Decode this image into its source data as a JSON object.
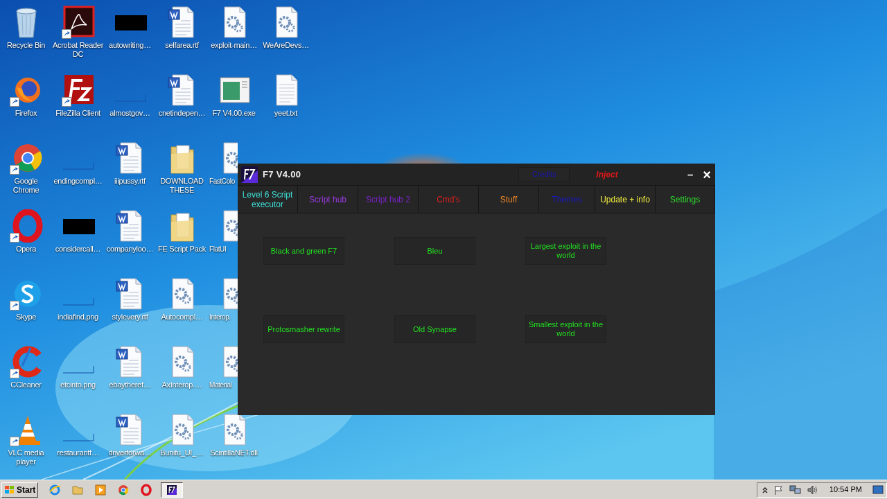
{
  "desktop_icons": [
    {
      "label": "Recycle Bin",
      "kind": "recycle",
      "shortcut": false,
      "clipped": false
    },
    {
      "label": "Firefox",
      "kind": "firefox",
      "shortcut": true,
      "clipped": false
    },
    {
      "label": "Google Chrome",
      "kind": "chrome",
      "shortcut": true,
      "clipped": false
    },
    {
      "label": "Opera",
      "kind": "opera",
      "shortcut": true,
      "clipped": false
    },
    {
      "label": "Skype",
      "kind": "skype",
      "shortcut": true,
      "clipped": false
    },
    {
      "label": "CCleaner",
      "kind": "ccleaner",
      "shortcut": true,
      "clipped": false
    },
    {
      "label": "VLC media player",
      "kind": "vlc",
      "shortcut": true,
      "clipped": false
    },
    {
      "label": "Acrobat Reader DC",
      "kind": "acrobat",
      "shortcut": true,
      "clipped": false
    },
    {
      "label": "FileZilla Client",
      "kind": "filezilla",
      "shortcut": true,
      "clipped": false
    },
    {
      "label": "endingcompl…",
      "kind": "blank",
      "shortcut": false,
      "clipped": false
    },
    {
      "label": "considercall…",
      "kind": "black",
      "shortcut": false,
      "clipped": false
    },
    {
      "label": "indiafind.png",
      "kind": "blank",
      "shortcut": false,
      "clipped": false
    },
    {
      "label": "etcinto.png",
      "kind": "blank",
      "shortcut": false,
      "clipped": false
    },
    {
      "label": "restaurantf…",
      "kind": "blank",
      "shortcut": false,
      "clipped": false
    },
    {
      "label": "autowriting…",
      "kind": "black",
      "shortcut": false,
      "clipped": false
    },
    {
      "label": "almostgov…",
      "kind": "blank",
      "shortcut": false,
      "clipped": false
    },
    {
      "label": "iiipussy.rtf",
      "kind": "word",
      "shortcut": false,
      "clipped": false
    },
    {
      "label": "companyloo…",
      "kind": "word",
      "shortcut": false,
      "clipped": false
    },
    {
      "label": "stylevery.rtf",
      "kind": "word",
      "shortcut": false,
      "clipped": false
    },
    {
      "label": "ebaytheref…",
      "kind": "word",
      "shortcut": false,
      "clipped": false
    },
    {
      "label": "driverforwa…",
      "kind": "word",
      "shortcut": false,
      "clipped": false
    },
    {
      "label": "selfarea.rtf",
      "kind": "word",
      "shortcut": false,
      "clipped": false
    },
    {
      "label": "cnetindepen…",
      "kind": "word",
      "shortcut": false,
      "clipped": false
    },
    {
      "label": "DOWNLOAD THESE",
      "kind": "folder",
      "shortcut": false,
      "clipped": false
    },
    {
      "label": "FE Script Pack",
      "kind": "folder",
      "shortcut": false,
      "clipped": false
    },
    {
      "label": "Autocompl…",
      "kind": "gear",
      "shortcut": false,
      "clipped": false
    },
    {
      "label": "AxInterop.…",
      "kind": "gear",
      "shortcut": false,
      "clipped": false
    },
    {
      "label": "Bunifu_UI_…",
      "kind": "gear",
      "shortcut": false,
      "clipped": false
    },
    {
      "label": "exploit-main…",
      "kind": "gear",
      "shortcut": false,
      "clipped": false
    },
    {
      "label": "F7 V4.00.exe",
      "kind": "exe",
      "shortcut": false,
      "clipped": false
    },
    {
      "label": "FastColo",
      "kind": "gear",
      "shortcut": false,
      "clipped": true
    },
    {
      "label": "FlatUI",
      "kind": "gear",
      "shortcut": false,
      "clipped": true
    },
    {
      "label": "Interop.",
      "kind": "gear",
      "shortcut": false,
      "clipped": true
    },
    {
      "label": "Material",
      "kind": "gear",
      "shortcut": false,
      "clipped": true
    },
    {
      "label": "ScintillaNET.dll",
      "kind": "gear",
      "shortcut": false,
      "clipped": false
    },
    {
      "label": "WeAreDevs…",
      "kind": "gear",
      "shortcut": false,
      "clipped": false
    },
    {
      "label": "yeet.txt",
      "kind": "text",
      "shortcut": false,
      "clipped": false
    }
  ],
  "window": {
    "title": "F7 V4.00",
    "credits": "Credits",
    "inject": "Inject",
    "minimize": "–",
    "close": "×",
    "tabs": [
      {
        "label": "Level 6 Script executor",
        "color": "#3ee0d8"
      },
      {
        "label": "Script hub",
        "color": "#9a3ae0"
      },
      {
        "label": "Script hub 2",
        "color": "#7a22c8"
      },
      {
        "label": "Cmd's",
        "color": "#e02020"
      },
      {
        "label": "Stuff",
        "color": "#f08a28"
      },
      {
        "label": "Themes",
        "color": "#1818c8"
      },
      {
        "label": "Update + info",
        "color": "#f4f040"
      },
      {
        "label": "Settings",
        "color": "#2ed82e"
      }
    ],
    "themes": [
      "Black and green F7",
      "Bleu",
      "Largest exploit in the world",
      "Protosmasher rewrite",
      "Old Synapse",
      "Smallest exploit in the world"
    ]
  },
  "taskbar": {
    "start": "Start",
    "apps": [
      {
        "kind": "ie",
        "selected": false
      },
      {
        "kind": "explorer",
        "selected": false
      },
      {
        "kind": "media",
        "selected": false
      },
      {
        "kind": "chrome",
        "selected": false
      },
      {
        "kind": "opera",
        "selected": false
      },
      {
        "kind": "f7",
        "selected": true
      }
    ],
    "clock": "10:54 PM"
  }
}
